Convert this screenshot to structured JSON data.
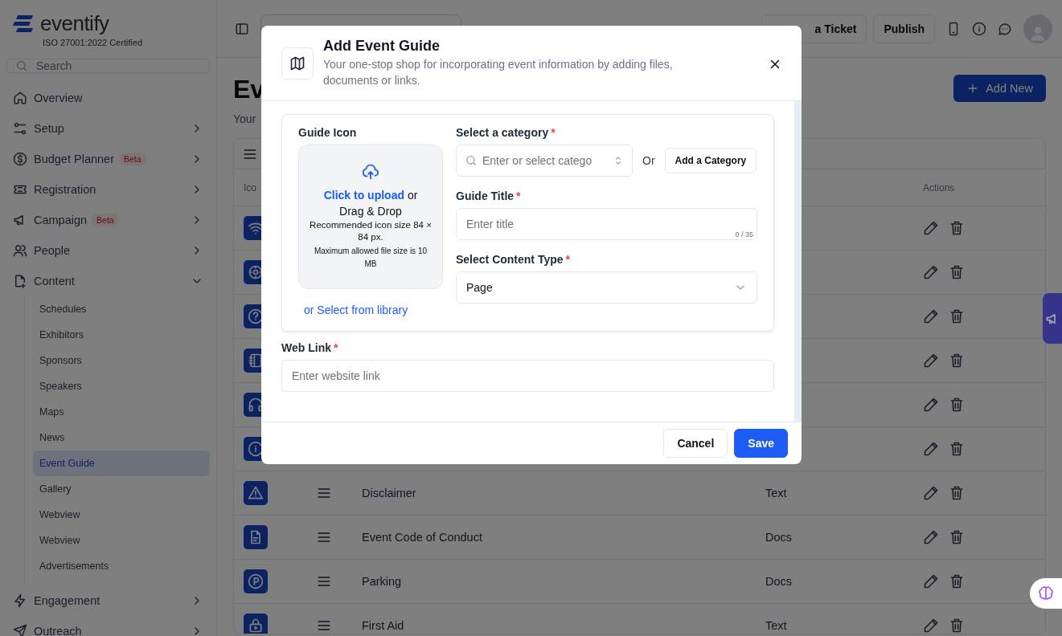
{
  "sidebar": {
    "logo": "eventify",
    "certification": "ISO 27001:2022 Certified",
    "search": {
      "placeholder": "Search"
    },
    "items": [
      {
        "kind": "link",
        "label": "Overview",
        "selected": false
      },
      {
        "kind": "group",
        "label": "Setup",
        "expanded": false
      },
      {
        "kind": "group",
        "label": "Budget Planner",
        "badge": "Beta",
        "expanded": false
      },
      {
        "kind": "group",
        "label": "Registration",
        "expanded": false
      },
      {
        "kind": "group",
        "label": "Campaign",
        "badge": "Beta",
        "expanded": false
      },
      {
        "kind": "group",
        "label": "People",
        "expanded": false
      },
      {
        "kind": "group",
        "label": "Content",
        "expanded": true,
        "children": [
          {
            "label": "Schedules",
            "selected": false
          },
          {
            "label": "Exhibitors",
            "selected": false
          },
          {
            "label": "Sponsors",
            "selected": false
          },
          {
            "label": "Speakers",
            "selected": false
          },
          {
            "label": "Maps",
            "selected": false
          },
          {
            "label": "News",
            "selected": false
          },
          {
            "label": "Event Guide",
            "selected": true
          },
          {
            "label": "Gallery",
            "selected": false
          },
          {
            "label": "Webview",
            "selected": false
          },
          {
            "label": "Webview",
            "selected": false
          },
          {
            "label": "Advertisements",
            "selected": false
          }
        ]
      },
      {
        "kind": "group",
        "label": "Engagement",
        "expanded": false
      },
      {
        "kind": "group",
        "label": "Outreach",
        "expanded": false
      }
    ]
  },
  "topbar": {
    "buttons": [
      {
        "kind": "ticket",
        "label": "a Ticket"
      },
      {
        "kind": "plain",
        "label": "Publish"
      }
    ]
  },
  "main": {
    "heading": "Ev",
    "subtitle": "Your",
    "add_button": "Add New",
    "table": {
      "columns": [
        "Ico",
        "Actions"
      ],
      "rows": [
        {},
        {},
        {},
        {},
        {},
        {},
        {
          "name": "Disclaimer",
          "type": "Text"
        },
        {
          "name": "Event Code of Conduct",
          "type": "Docs"
        },
        {
          "name": "Parking",
          "type": "Docs"
        },
        {
          "name": "First Aid",
          "type": "Text"
        }
      ]
    }
  },
  "dialog": {
    "title": "Add Event Guide",
    "subtitle": "Your one-stop shop for incorporating event information by adding files, documents or links.",
    "guide_icon": {
      "label": "Guide Icon",
      "upload_link": "Click to upload",
      "upload_text": " or Drag & Drop",
      "recommended": "Recommended icon size 84 × 84 px.",
      "max_size": "Maximum allowed file size is 10 MB",
      "library_link": "or Select from library"
    },
    "category": {
      "label": "Select a category",
      "required_mark": "*",
      "placeholder": "Enter or select catego",
      "or": "Or",
      "add_button": "Add a Category"
    },
    "title_field": {
      "label": "Guide Title",
      "required_mark": "*",
      "placeholder": "Enter title",
      "counter": "0 / 35"
    },
    "content_type": {
      "label": "Select Content Type",
      "required_mark": "*",
      "value": "Page"
    },
    "web_link": {
      "label": "Web Link",
      "required_mark": "*",
      "placeholder": "Enter website link"
    },
    "buttons": [
      {
        "kind": "secondary",
        "label": "Cancel"
      },
      {
        "kind": "primary",
        "label": "Save"
      }
    ]
  }
}
